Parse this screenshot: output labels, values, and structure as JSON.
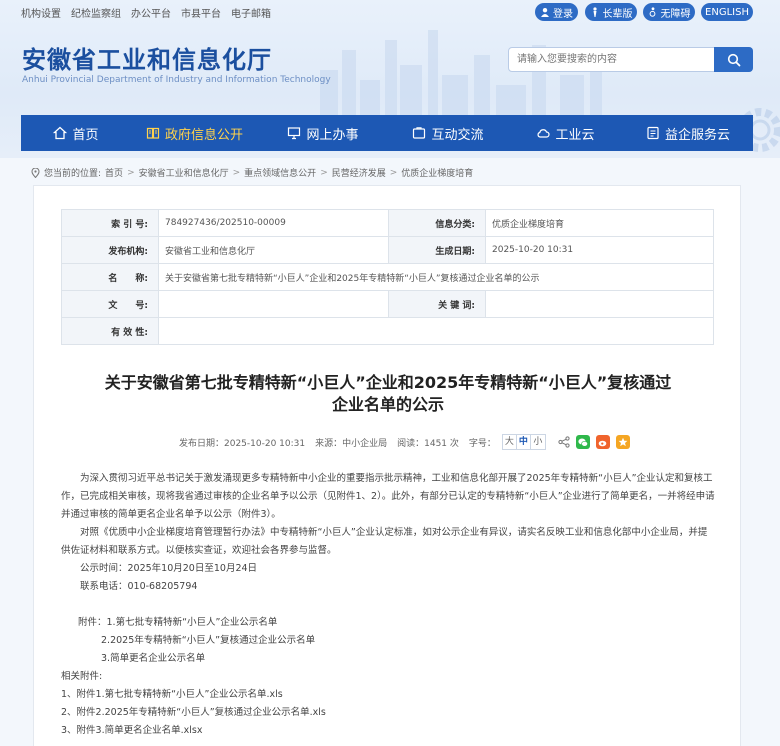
{
  "topbar": {
    "links": [
      "机构设置",
      "纪检监察组",
      "办公平台",
      "市县平台",
      "电子邮箱"
    ],
    "login": "登录",
    "elder": "长辈版",
    "accessible": "无障碍",
    "english": "ENGLISH"
  },
  "header": {
    "title": "安徽省工业和信息化厅",
    "subtitle": "Anhui Provincial Department of Industry and Information Technology",
    "search_placeholder": "请输入您要搜索的内容"
  },
  "nav": [
    {
      "label": "首页",
      "icon": "home-icon"
    },
    {
      "label": "政府信息公开",
      "icon": "book-icon",
      "active": true
    },
    {
      "label": "网上办事",
      "icon": "monitor-icon"
    },
    {
      "label": "互动交流",
      "icon": "chat-icon"
    },
    {
      "label": "工业云",
      "icon": "cloud-icon"
    },
    {
      "label": "益企服务云",
      "icon": "service-icon"
    }
  ],
  "breadcrumb": {
    "prefix": "您当前的位置:",
    "items": [
      "首页",
      "安徽省工业和信息化厅",
      "重点领域信息公开",
      "民营经济发展",
      "优质企业梯度培育"
    ]
  },
  "meta": {
    "index_label": "索 引 号:",
    "index_value": "784927436/202510-00009",
    "category_label": "信息分类:",
    "category_value": "优质企业梯度培育",
    "org_label": "发布机构:",
    "org_value": "安徽省工业和信息化厅",
    "date_label": "生成日期:",
    "date_value": "2025-10-20 10:31",
    "name_label": "名　　称:",
    "name_value": "关于安徽省第七批专精特新“小巨人”企业和2025年专精特新“小巨人”复核通过企业名单的公示",
    "docno_label": "文　　号:",
    "docno_value": "",
    "keywords_label": "关 键 词:",
    "keywords_value": "",
    "validity_label": "有 效 性:",
    "validity_value": ""
  },
  "article": {
    "title_line1": "关于安徽省第七批专精特新“小巨人”企业和2025年专精特新“小巨人”复核通过",
    "title_line2": "企业名单的公示",
    "publish_date": "发布日期：2025-10-20 10:31",
    "source": "来源：中小企业局",
    "views": "阅读：1451 次",
    "font_label": "字号：",
    "font_sizes": [
      "大",
      "中",
      "小"
    ],
    "paragraphs": [
      "为深入贯彻习近平总书记关于激发涌现更多专精特新中小企业的重要指示批示精神，工业和信息化部开展了2025年专精特新“小巨人”企业认定和复核工作，已完成相关审核，现将我省通过审核的企业名单予以公示（见附件1、2）。此外，有部分已认定的专精特新“小巨人”企业进行了简单更名，一并将经申请并通过审核的简单更名企业名单予以公示（附件3）。",
      "对照《优质中小企业梯度培育管理暂行办法》中专精特新“小巨人”企业认定标准，如对公示企业有异议，请实名反映工业和信息化部中小企业局，并提供佐证材料和联系方式。以便核实查证，欢迎社会各界参与监督。"
    ],
    "period": "公示时间：2025年10月20日至10月24日",
    "phone": "联系电话：010-68205794",
    "attach_heading": "附件：1.第七批专精特新“小巨人”企业公示名单",
    "attach_2": "2.2025年专精特新“小巨人”复核通过企业公示名单",
    "attach_3": "3.简单更名企业公示名单",
    "related_heading": "相关附件:",
    "files": [
      "1、附件1.第七批专精特新“小巨人”企业公示名单.xls",
      "2、附件2.2025年专精特新“小巨人”复核通过企业公示名单.xls",
      "3、附件3.简单更名企业名单.xlsx"
    ]
  },
  "colors": {
    "primary": "#1d58b4",
    "active_nav": "#ffd24c",
    "wechat": "#2fb84b",
    "weibo": "#f0642d",
    "qzone": "#f5a623"
  }
}
